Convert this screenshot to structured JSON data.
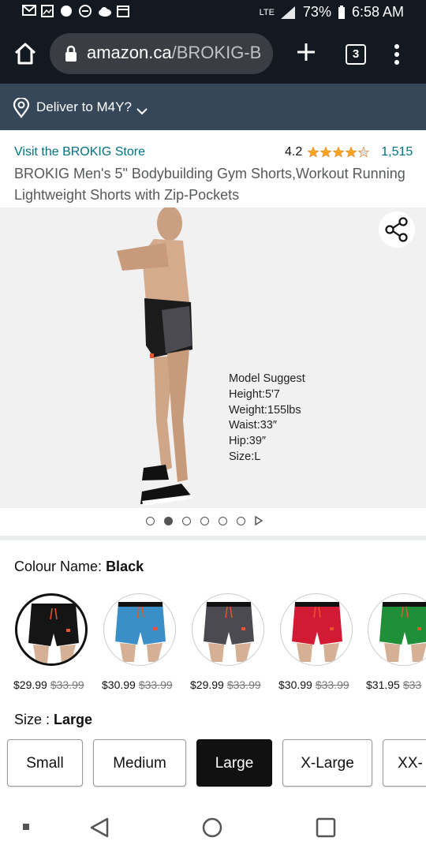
{
  "status": {
    "battery": "73%",
    "time": "6:58 AM",
    "network": "LTE"
  },
  "browser": {
    "url_domain": "amazon.ca",
    "url_path": "/BROKIG-B",
    "tab_count": "3"
  },
  "deliver": {
    "text": "Deliver to M4Y?"
  },
  "product": {
    "store_link": "Visit the BROKIG Store",
    "rating": "4.2",
    "rating_value": 4.2,
    "rating_count": "1,515",
    "title": "BROKIG Men's 5\" Bodybuilding Gym Shorts,Workout Running Lightweight Shorts with Zip-Pockets"
  },
  "gallery": {
    "model_suggest": [
      "Model Suggest",
      "Height:5'7",
      "Weight:155lbs",
      "Waist:33″",
      "Hip:39″",
      "Size:L"
    ],
    "image_count": 6,
    "active_index": 1
  },
  "colour": {
    "label": "Colour Name:",
    "selected": "Black",
    "swatches": [
      {
        "color": "#151515",
        "price": "$29.99",
        "old_price": "$33.99"
      },
      {
        "color": "#3a8fc9",
        "price": "$30.99",
        "old_price": "$33.99"
      },
      {
        "color": "#4a4a50",
        "price": "$29.99",
        "old_price": "$33.99"
      },
      {
        "color": "#d31a35",
        "price": "$30.99",
        "old_price": "$33.99"
      },
      {
        "color": "#1f8f3a",
        "price": "$31.95",
        "old_price": "$33"
      }
    ]
  },
  "size": {
    "label": "Size :",
    "selected": "Large",
    "options": [
      "Small",
      "Medium",
      "Large",
      "X-Large",
      "XX-"
    ]
  },
  "colors": {
    "nav_dark": "#131921",
    "deliver_bg": "#37475a",
    "link": "#007185",
    "star": "#ffa41c"
  }
}
